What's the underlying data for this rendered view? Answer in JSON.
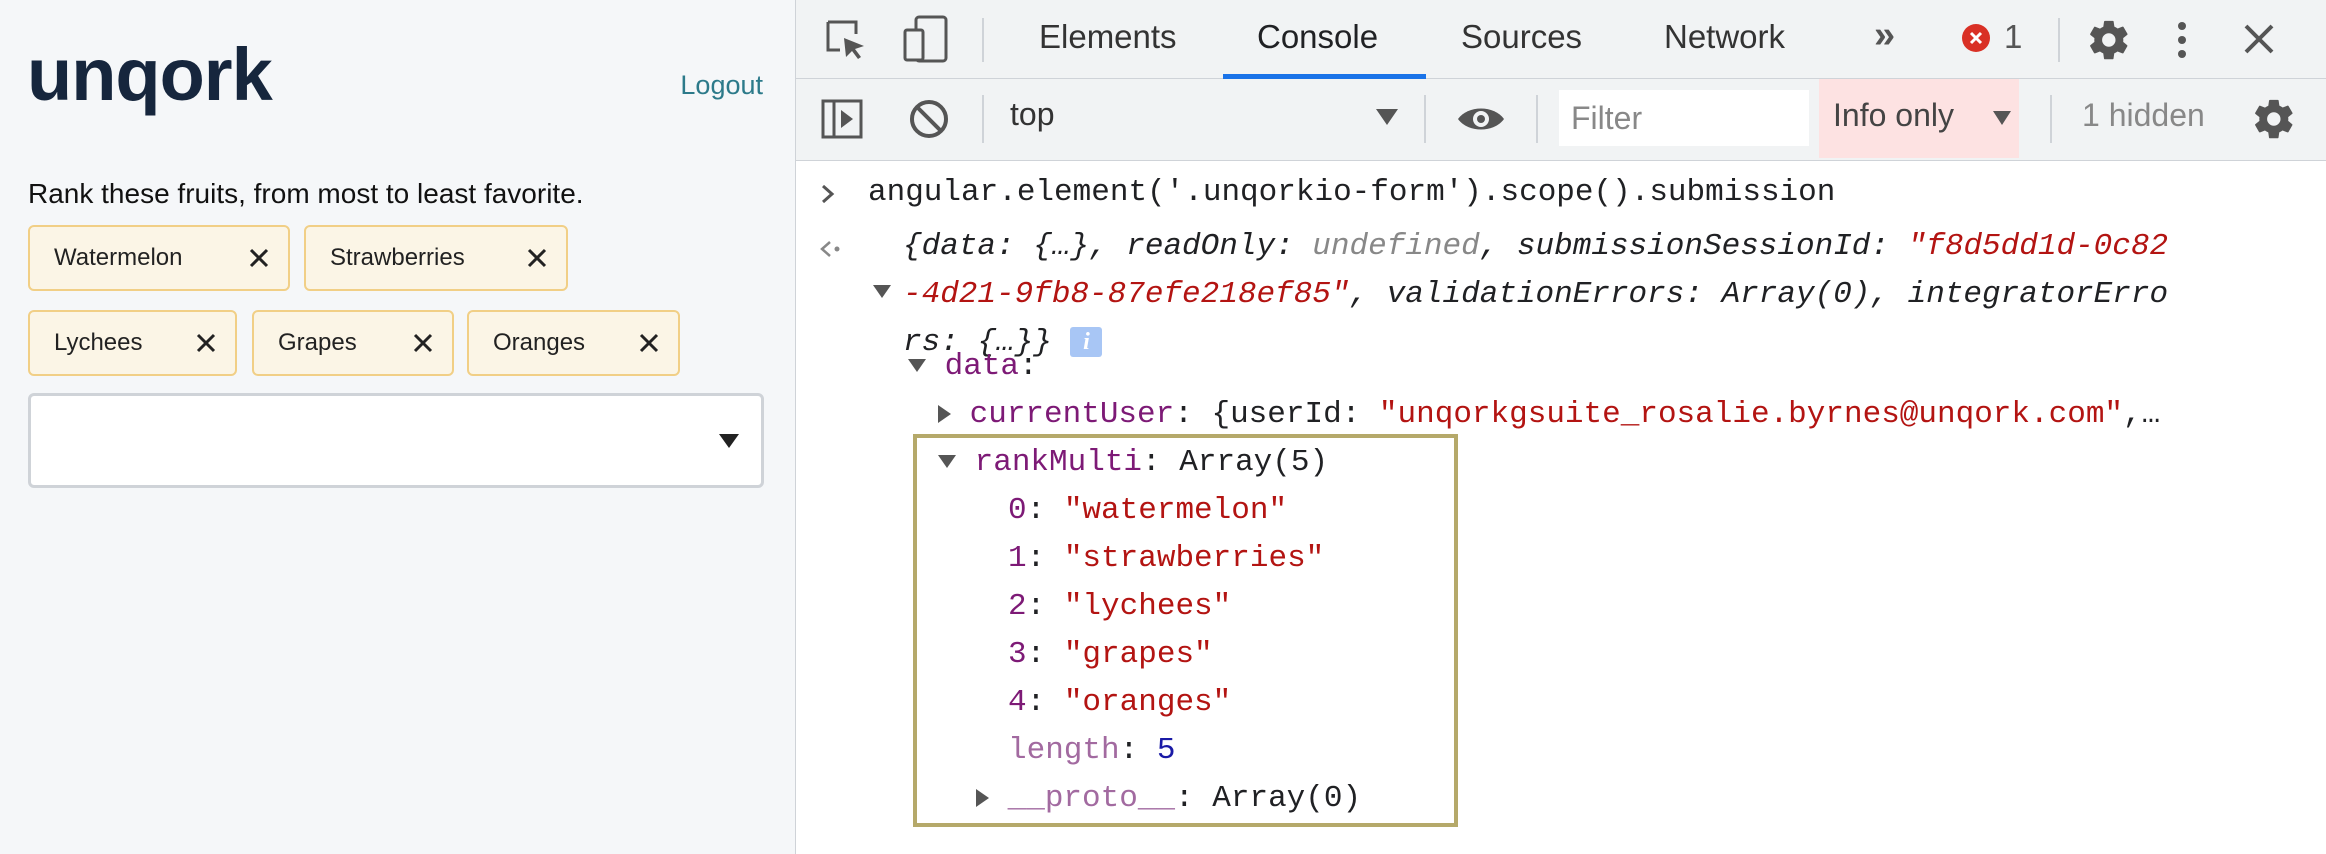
{
  "app": {
    "logo": "unqork",
    "logout": "Logout",
    "instruction": "Rank these fruits, from most to least favorite.",
    "chips": [
      "Watermelon",
      "Strawberries",
      "Lychees",
      "Grapes",
      "Oranges"
    ]
  },
  "devtools": {
    "tabs": [
      "Elements",
      "Console",
      "Sources",
      "Network"
    ],
    "active_tab": "Console",
    "more": "»",
    "error_count": "1",
    "context": "top",
    "filter_placeholder": "Filter",
    "level": "Info only",
    "hidden": "1 hidden"
  },
  "console": {
    "command": "angular.element('.unqorkio-form').scope().submission",
    "summary": {
      "p1": "{data: {…}, ",
      "readOnly_key": "readOnly",
      "readOnly_val": "undefined",
      "session_key": "submissionSessionId",
      "session_val_1": "\"f8d5dd1d-0c82",
      "session_val_2": "-4d21-9fb8-87efe218ef85\"",
      "validation": "validationErrors",
      "validation_val": "Array(0)",
      "integ_1": "integratorErro",
      "integ_2": "rs",
      "integ_val": "{…}}"
    },
    "data_key": "data",
    "current_user_key": "currentUser",
    "current_user_val": "{userId: ",
    "current_user_str": "\"unqorkgsuite_rosalie.byrnes@unqork.com\"",
    "current_user_tail": ",…",
    "rank_key": "rankMulti",
    "rank_val": "Array(5)",
    "items": [
      {
        "idx": "0",
        "val": "\"watermelon\""
      },
      {
        "idx": "1",
        "val": "\"strawberries\""
      },
      {
        "idx": "2",
        "val": "\"lychees\""
      },
      {
        "idx": "3",
        "val": "\"grapes\""
      },
      {
        "idx": "4",
        "val": "\"oranges\""
      }
    ],
    "length_key": "length",
    "length_val": "5",
    "proto_key": "__proto__",
    "proto_val": "Array(0)"
  }
}
